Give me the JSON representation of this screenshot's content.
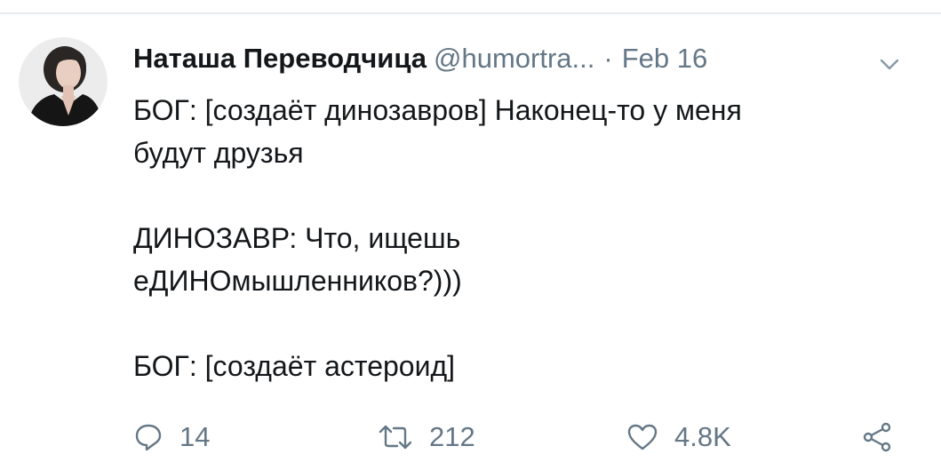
{
  "tweet": {
    "author_name": "Наташа Переводчица",
    "author_handle": "@humortra...",
    "separator": "·",
    "date": "Feb 16",
    "text_lines": [
      "БОГ: [создаёт динозавров] Наконец-то у меня",
      "будут друзья",
      "",
      "ДИНОЗАВР: Что, ищешь",
      "еДИНОмышленников?)))",
      "",
      "БОГ: [создаёт астероид]"
    ]
  },
  "actions": {
    "reply_count": "14",
    "retweet_count": "212",
    "like_count": "4.8K"
  },
  "icons": {
    "menu": "chevron-down-icon",
    "reply": "reply-icon",
    "retweet": "retweet-icon",
    "like": "heart-icon",
    "share": "share-icon"
  },
  "colors": {
    "text": "#14171a",
    "secondary": "#657786",
    "divider": "#e6ecf0"
  }
}
